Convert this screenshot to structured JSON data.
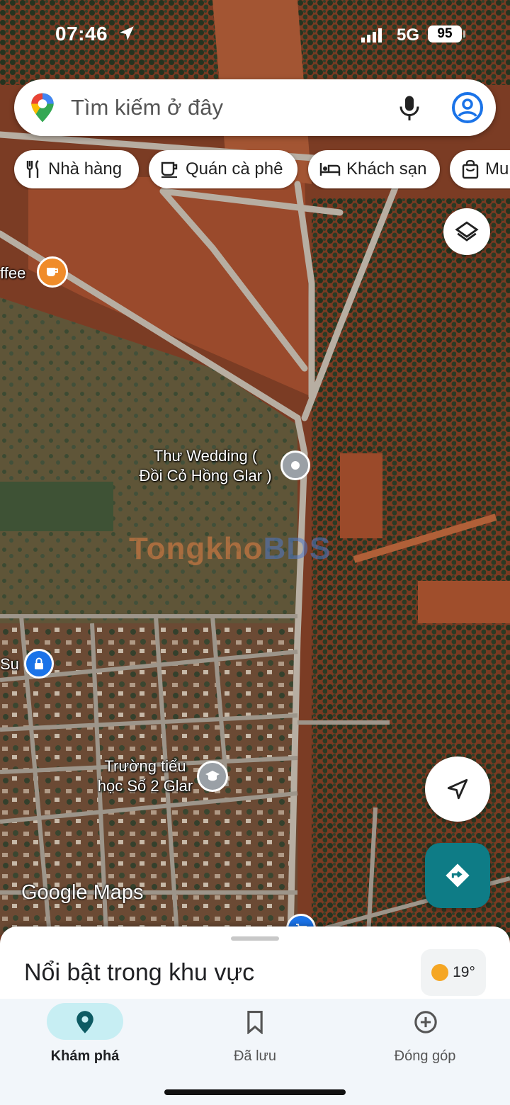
{
  "status_bar": {
    "time": "07:46",
    "network": "5G",
    "battery": "95"
  },
  "search": {
    "placeholder": "Tìm kiếm ở đây"
  },
  "chips": [
    {
      "label": "Nhà hàng",
      "icon": "fork-knife-icon"
    },
    {
      "label": "Quán cà phê",
      "icon": "coffee-cup-icon"
    },
    {
      "label": "Khách sạn",
      "icon": "bed-icon"
    },
    {
      "label": "Mu",
      "icon": "shopping-bag-icon"
    }
  ],
  "map_labels": {
    "coffee": "ffee",
    "wedding_line1": "Thư Wedding (",
    "wedding_line2": "Đồi Cỏ Hồng Glar )",
    "su": "Su",
    "school_line1": "Trường tiểu",
    "school_line2": "học Số 2 Glar",
    "watermark": "Tongkho",
    "watermark_suffix": "BDS",
    "google_maps": "Google Maps"
  },
  "sheet": {
    "title": "Nổi bật trong khu vực",
    "temperature": "19°"
  },
  "nav": [
    {
      "label": "Khám phá",
      "icon": "location-pin-icon",
      "active": true
    },
    {
      "label": "Đã lưu",
      "icon": "bookmark-icon",
      "active": false
    },
    {
      "label": "Đóng góp",
      "icon": "add-circle-icon",
      "active": false
    }
  ],
  "colors": {
    "accent": "#0e7c86",
    "active_pill": "#c7eef3",
    "coffee_marker": "#f08c2a",
    "place_marker": "#9aa0a6",
    "lock_marker": "#1a73e8"
  }
}
